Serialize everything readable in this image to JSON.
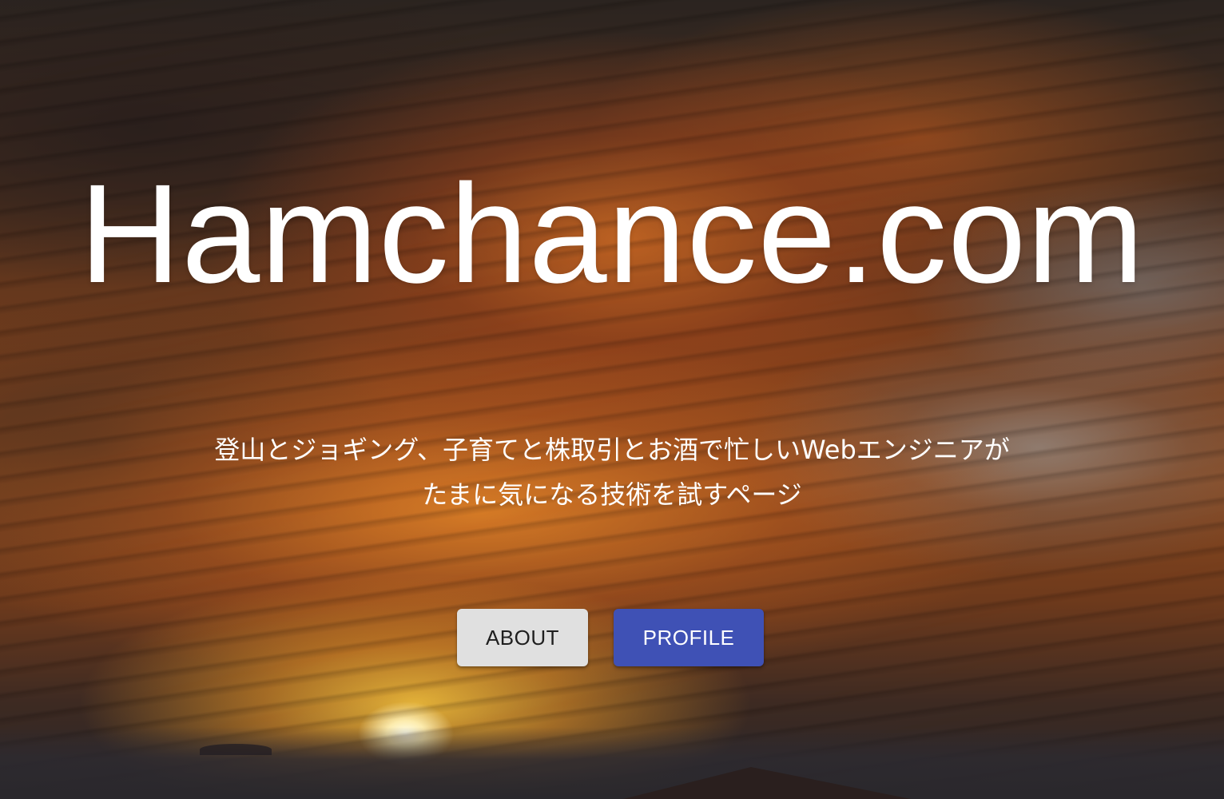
{
  "hero": {
    "title": "Hamchance.com",
    "tagline_line1": "登山とジョギング、子育てと株取引とお酒で忙しいWebエンジニアが",
    "tagline_line2": "たまに気になる技術を試すページ"
  },
  "actions": {
    "about_label": "ABOUT",
    "profile_label": "PROFILE"
  },
  "colors": {
    "about_button_bg": "#e0e0e0",
    "profile_button_bg": "#3f51b5",
    "title_text": "#ffffff"
  }
}
